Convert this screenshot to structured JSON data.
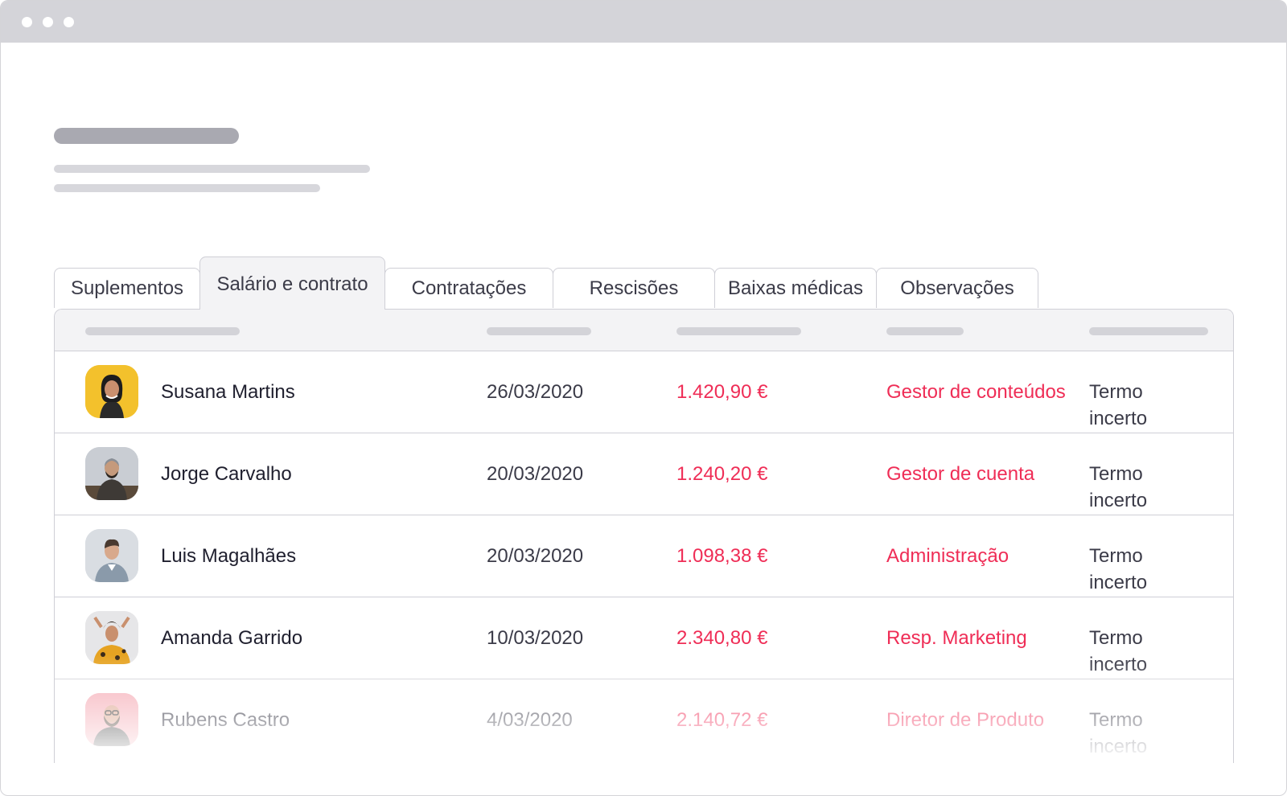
{
  "tabs": [
    {
      "label": "Suplementos",
      "active": false
    },
    {
      "label": "Salário e contrato",
      "active": true
    },
    {
      "label": "Contratações",
      "active": false
    },
    {
      "label": "Rescisões",
      "active": false
    },
    {
      "label": "Baixas médicas",
      "active": false
    },
    {
      "label": "Observações",
      "active": false
    }
  ],
  "rows": [
    {
      "name": "Susana Martins",
      "date": "26/03/2020",
      "amount": "1.420,90 €",
      "role": "Gestor de conteúdos",
      "contract": "Termo incerto",
      "avatar_bg": "#f3c12c"
    },
    {
      "name": "Jorge Carvalho",
      "date": "20/03/2020",
      "amount": "1.240,20 €",
      "role": "Gestor de cuenta",
      "contract": "Termo incerto",
      "avatar_bg": "#c9cdd3"
    },
    {
      "name": "Luis Magalhães",
      "date": "20/03/2020",
      "amount": "1.098,38 €",
      "role": "Administração",
      "contract": "Termo incerto",
      "avatar_bg": "#d9dde2"
    },
    {
      "name": "Amanda Garrido",
      "date": "10/03/2020",
      "amount": "2.340,80 €",
      "role": "Resp. Marketing",
      "contract": "Termo incerto",
      "avatar_bg": "#e6e6e8"
    },
    {
      "name": "Rubens Castro",
      "date": "4/03/2020",
      "amount": "2.140,72 €",
      "role": "Diretor de Produto",
      "contract": "Termo incerto",
      "avatar_bg": "#f5aab4"
    }
  ],
  "colors": {
    "accent": "#ef2d56",
    "titlebar": "#d4d4d9",
    "header_bg": "#f3f3f5",
    "border": "#cfcfd6"
  }
}
